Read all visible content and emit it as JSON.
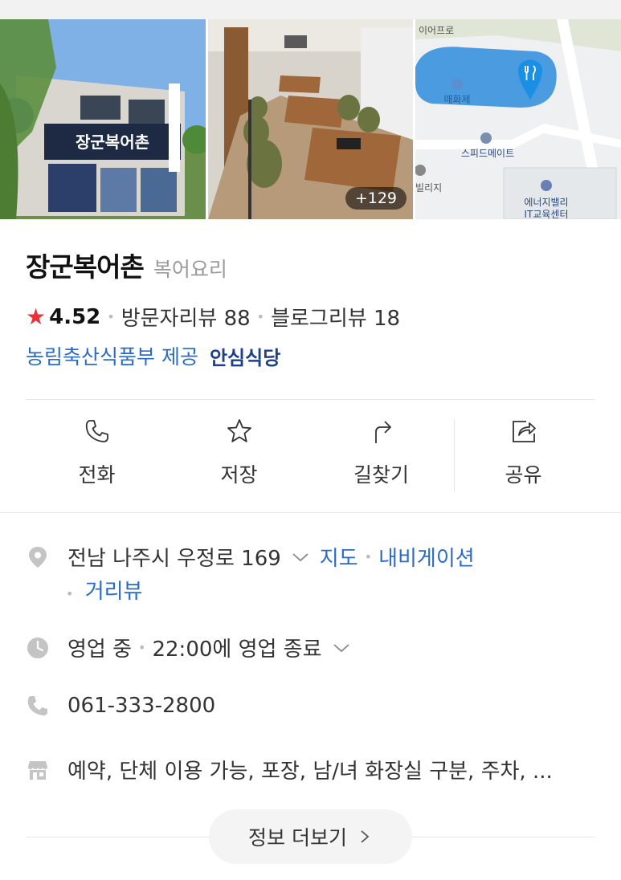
{
  "place": {
    "name": "장군복어촌",
    "category": "복어요리",
    "rating": "4.52",
    "visitor_reviews": "방문자리뷰 88",
    "blog_reviews": "블로그리뷰 18",
    "provider": "농림축산식품부 제공",
    "badge": "안심식당",
    "sign_text": "장군복어촌"
  },
  "gallery": {
    "more_count": "+129",
    "map_labels": {
      "top": "이어프로",
      "lake": "매화제",
      "mart": "스피드메이트",
      "village": "빌리지",
      "center_1": "에너지밸리",
      "center_2": "IT교육센터"
    }
  },
  "actions": [
    {
      "label": "전화",
      "icon": "phone-icon"
    },
    {
      "label": "저장",
      "icon": "star-icon"
    },
    {
      "label": "길찾기",
      "icon": "directions-icon"
    },
    {
      "label": "공유",
      "icon": "share-icon"
    }
  ],
  "info": {
    "address": "전남 나주시 우정로 169",
    "map_link": "지도",
    "navigation_link": "내비게이션",
    "street_view_link": "거리뷰",
    "status": "영업 중",
    "closing": "22:00에 영업 종료",
    "phone": "061-333-2800",
    "amenities": "예약, 단체 이용 가능, 포장, 남/녀 화장실 구분, 주차, ..."
  },
  "more_button": "정보 더보기",
  "colors": {
    "link": "#2b6bc7",
    "star": "#e8333a",
    "badge": "#1c3f8a",
    "map_pin": "#1a8fe3"
  }
}
